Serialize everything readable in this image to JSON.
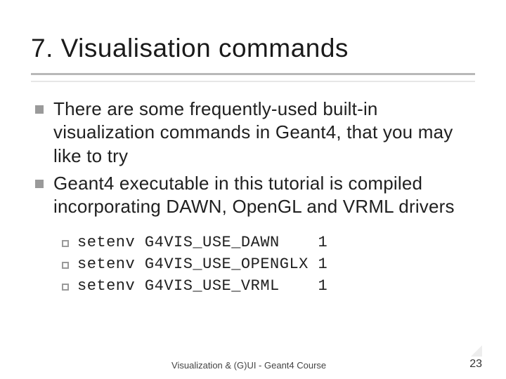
{
  "title": "7. Visualisation commands",
  "bullets": [
    "There are some frequently-used built-in visualization commands in Geant4, that you may like to try",
    "Geant4 executable in this tutorial is compiled incorporating DAWN, OpenGL and VRML drivers"
  ],
  "env": [
    "setenv G4VIS_USE_DAWN    1",
    "setenv G4VIS_USE_OPENGLX 1",
    "setenv G4VIS_USE_VRML    1"
  ],
  "footer": "Visualization & (G)UI - Geant4 Course",
  "page": "23"
}
